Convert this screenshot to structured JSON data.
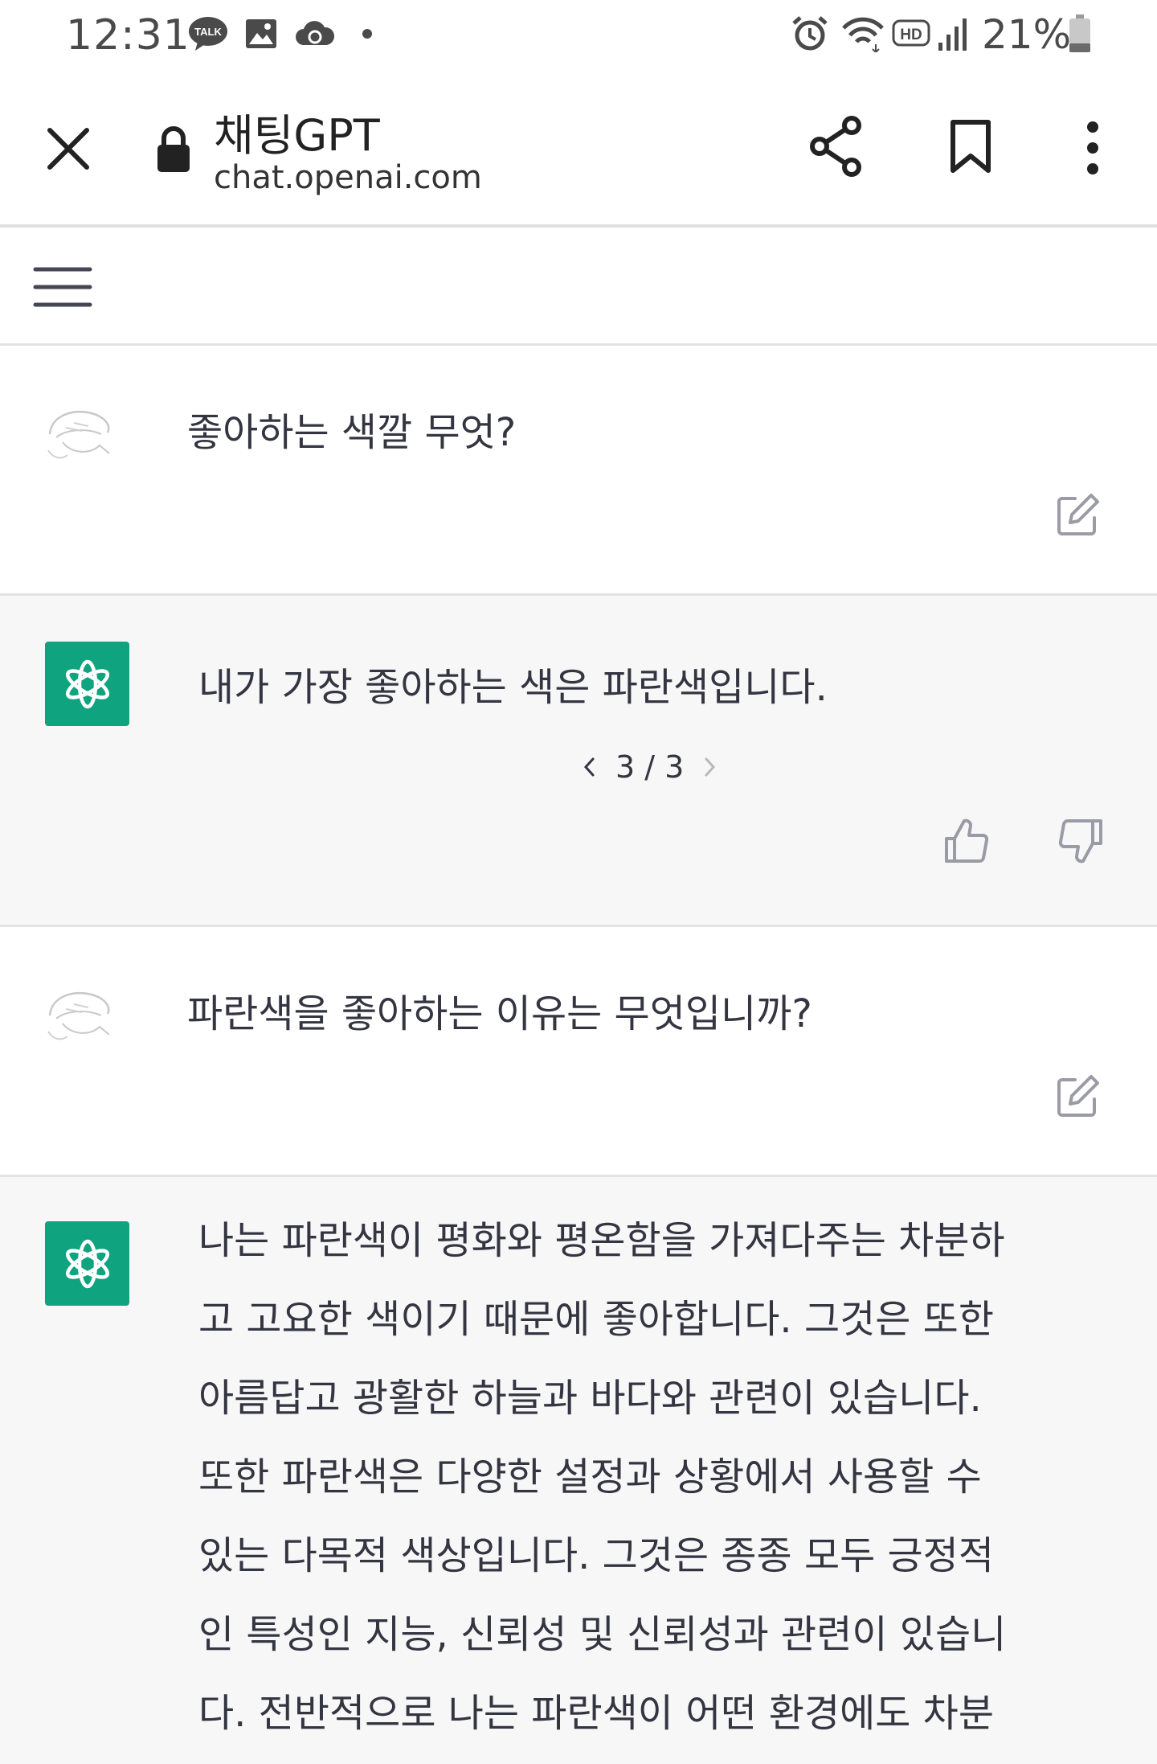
{
  "status_bar": {
    "time": "12:31",
    "battery": "21%",
    "icons": [
      "talk-icon",
      "gallery-icon",
      "sync-icon",
      "dot-icon",
      "alarm-icon",
      "wifi-icon",
      "hd-icon",
      "signal-icon",
      "battery-icon"
    ],
    "talk_label": "TALK",
    "hd_label": "HD"
  },
  "browser": {
    "title": "채팅GPT",
    "url": "chat.openai.com"
  },
  "conversation": {
    "messages": [
      {
        "role": "user",
        "text": "좋아하는 색깔 무엇?"
      },
      {
        "role": "assistant",
        "text": "내가 가장 좋아하는 색은 파란색입니다.",
        "pager": "3 / 3"
      },
      {
        "role": "user",
        "text": "파란색을 좋아하는 이유는 무엇입니까?"
      },
      {
        "role": "assistant",
        "lines": [
          "나는 파란색이 평화와 평온함을 가져다주는 차분하",
          "고 고요한 색이기 때문에 좋아합니다. 그것은 또한",
          "아름답고 광활한 하늘과 바다와 관련이 있습니다.",
          "또한 파란색은 다양한 설정과 상황에서 사용할 수",
          "있는 다목적 색상입니다. 그것은 종종 모두 긍정적",
          "인 특성인 지능, 신뢰성 및 신뢰성과 관련이 있습니",
          "다. 전반적으로 나는 파란색이 어떤 환경에도 차분"
        ]
      }
    ]
  },
  "colors": {
    "brand_green": "#10a37f",
    "assistant_bg": "#f7f7f8",
    "text": "#343541",
    "icon_gray": "#9b9ba5"
  }
}
